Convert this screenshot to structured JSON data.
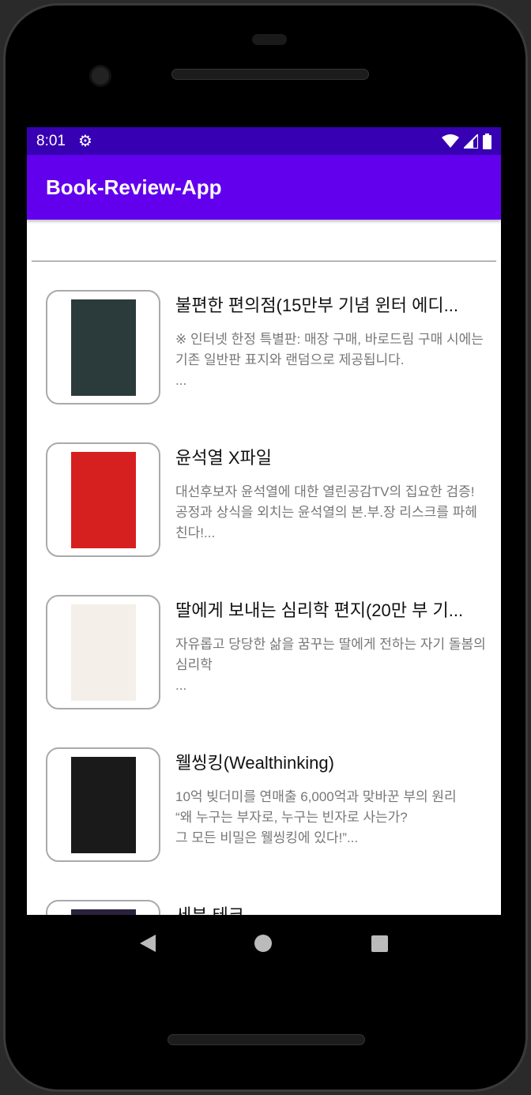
{
  "status_bar": {
    "time": "8:01",
    "icons": [
      "gear-icon",
      "wifi-icon",
      "signal-icon",
      "battery-icon"
    ]
  },
  "app_bar": {
    "title": "Book-Review-App"
  },
  "books": [
    {
      "title": "불편한 편의점(15만부 기념 윈터 에디...",
      "description": "※ 인터넷 한정 특별판: 매장 구매, 바로드림 구매 시에는 기존 일반판 표지와 랜덤으로 제공됩니다.\n...",
      "cover_color": "#2b3a3a"
    },
    {
      "title": "윤석열 X파일",
      "description": "대선후보자 윤석열에 대한 열린공감TV의 집요한 검증! 공정과 상식을 외치는 윤석열의 본.부.장 리스크를 파헤친다!...",
      "cover_color": "#d61f1f"
    },
    {
      "title": "딸에게 보내는 심리학 편지(20만 부 기...",
      "description": "자유롭고 당당한 삶을 꿈꾸는 딸에게 전하는 자기 돌봄의 심리학\n...",
      "cover_color": "#f4efe8"
    },
    {
      "title": "웰씽킹(Wealthinking)",
      "description": "10억 빚더미를 연매출 6,000억과 맞바꾼 부의 원리\n“왜 누구는 부자로, 누구는 빈자로 사는가?\n 그 모든 비밀은 웰씽킹에 있다!”...",
      "cover_color": "#1a1a1a"
    },
    {
      "title": "세븐 테크",
      "description": "",
      "cover_color": "#2a2040"
    }
  ]
}
